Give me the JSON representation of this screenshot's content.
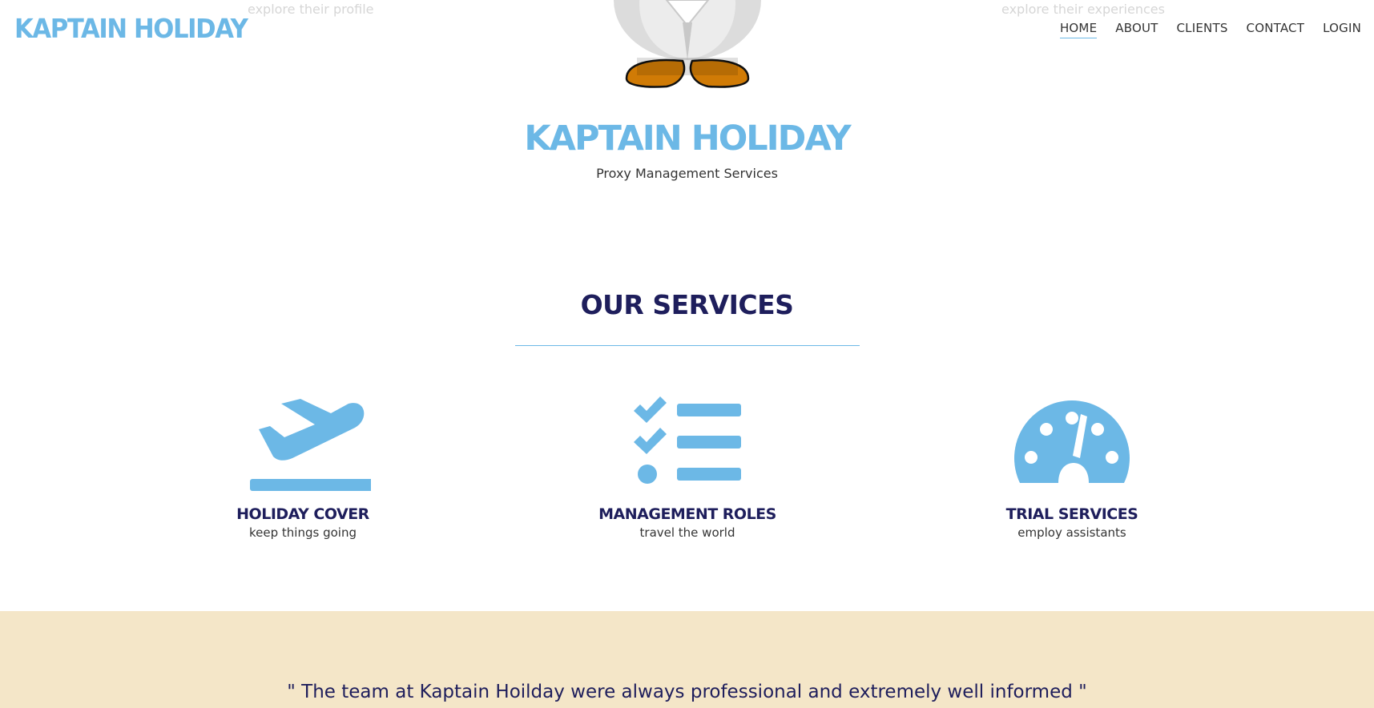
{
  "background_labels": [
    "explore their profile",
    "explore their experiences"
  ],
  "navbar": {
    "brand": "KAPTAIN HOLIDAY",
    "items": [
      {
        "label": "HOME",
        "active": true
      },
      {
        "label": "ABOUT",
        "active": false
      },
      {
        "label": "CLIENTS",
        "active": false
      },
      {
        "label": "CONTACT",
        "active": false
      },
      {
        "label": "LOGIN",
        "active": false
      }
    ]
  },
  "hero": {
    "title": "KAPTAIN HOLIDAY",
    "subtitle": "Proxy Management Services"
  },
  "services": {
    "heading": "OUR SERVICES",
    "items": [
      {
        "icon": "plane-departure-icon",
        "title": "HOLIDAY COVER",
        "subtitle": "keep things going"
      },
      {
        "icon": "checklist-icon",
        "title": "MANAGEMENT ROLES",
        "subtitle": "travel the world"
      },
      {
        "icon": "speedometer-icon",
        "title": "TRIAL SERVICES",
        "subtitle": "employ assistants"
      }
    ]
  },
  "testimonial": {
    "quote": "\" The team at Kaptain Hoilday were always professional and extremely well informed \""
  },
  "colors": {
    "brand_blue": "#6cb8e6",
    "navy": "#1e1e5c",
    "testimonial_bg": "#f4e6c8"
  }
}
